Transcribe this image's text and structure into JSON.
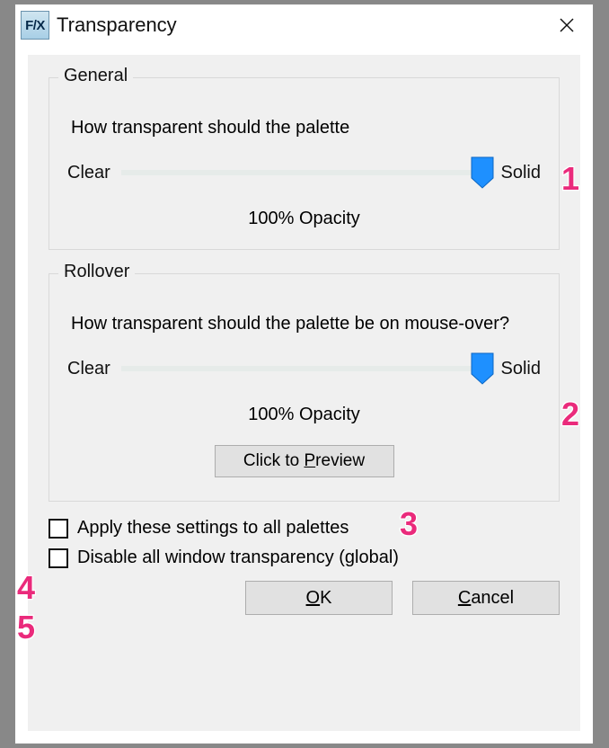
{
  "window": {
    "icon_label": "F/X",
    "title": "Transparency"
  },
  "general": {
    "legend": "General",
    "question": "How transparent should the palette",
    "slider": {
      "left_label": "Clear",
      "right_label": "Solid",
      "value_percent": 100
    },
    "opacity_text": "100% Opacity"
  },
  "rollover": {
    "legend": "Rollover",
    "question": "How transparent should the palette be on mouse-over?",
    "slider": {
      "left_label": "Clear",
      "right_label": "Solid",
      "value_percent": 100
    },
    "opacity_text": "100% Opacity",
    "preview_prefix": "Click to ",
    "preview_ul": "P",
    "preview_suffix": "review"
  },
  "checkbox_apply_all": "Apply these settings to all palettes",
  "checkbox_disable_global": "Disable all window transparency (global)",
  "buttons": {
    "ok_ul": "O",
    "ok_suffix": "K",
    "cancel_ul": "C",
    "cancel_suffix": "ancel"
  },
  "callouts": {
    "c1": "1",
    "c2": "2",
    "c3": "3",
    "c4": "4",
    "c5": "5"
  }
}
